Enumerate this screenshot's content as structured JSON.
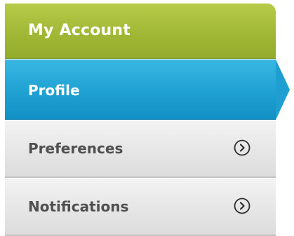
{
  "menu": {
    "header": {
      "label": "My Account"
    },
    "items": [
      {
        "label": "Profile",
        "active": true
      },
      {
        "label": "Preferences",
        "icon": "chevron-right-circle-icon"
      },
      {
        "label": "Notifications",
        "icon": "chevron-right-circle-icon"
      }
    ]
  },
  "colors": {
    "header_green": "#a1b836",
    "active_blue": "#21a3d4",
    "item_gray": "#e6e6e6",
    "item_text": "#505050",
    "white_text": "#ffffff"
  }
}
